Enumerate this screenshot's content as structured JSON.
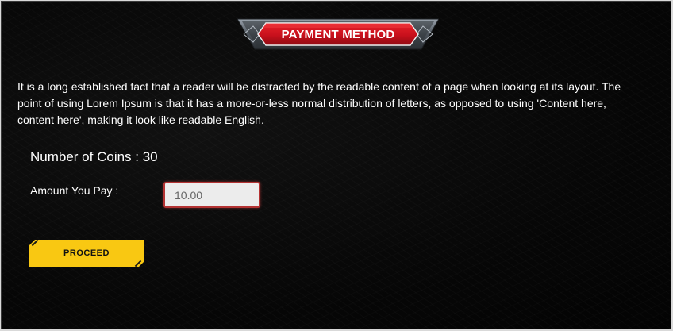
{
  "header": {
    "title": "PAYMENT METHOD"
  },
  "description": "It is a long established fact that a reader will be distracted by the readable content of a page when looking at its layout. The point of using Lorem Ipsum is that it has a more-or-less normal distribution of letters, as opposed to using 'Content here, content here', making it look like readable English.",
  "form": {
    "coins_text": "Number of Coins : 30",
    "amount_label": "Amount You Pay :",
    "amount_value": "10.00",
    "proceed_label": "PROCEED"
  },
  "colors": {
    "banner_red": "#c8101c",
    "button_yellow": "#f9c812",
    "background": "#070707"
  }
}
